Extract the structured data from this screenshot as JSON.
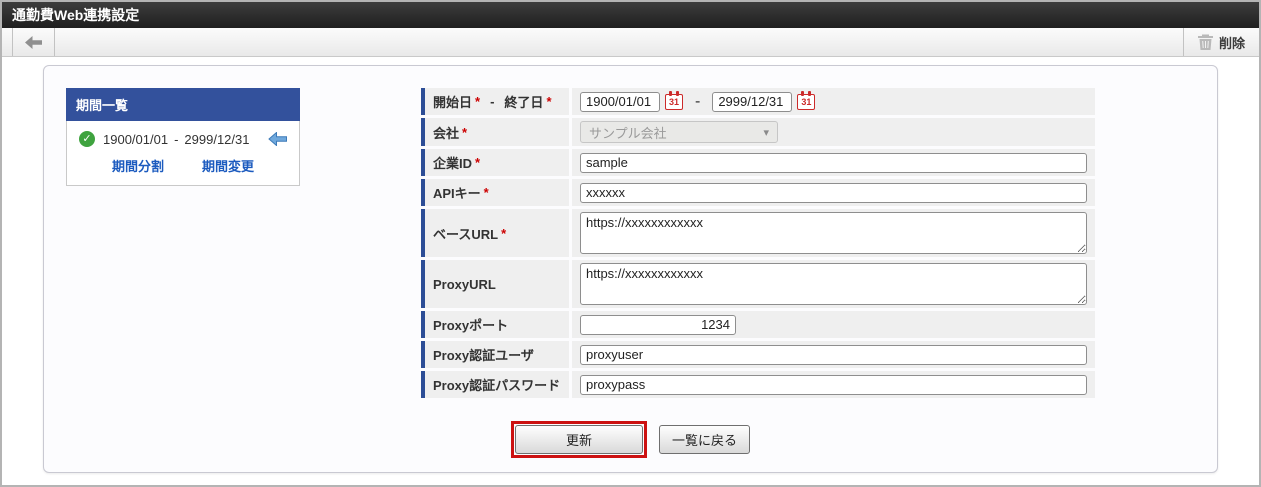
{
  "title_bar": {
    "title": "通勤費Web連携設定"
  },
  "toolbar": {
    "delete_label": "削除"
  },
  "period_panel": {
    "title": "期間一覧",
    "entry": {
      "start": "1900/01/01",
      "separator": "-",
      "end": "2999/12/31"
    },
    "links": {
      "split": "期間分割",
      "change": "期間変更"
    }
  },
  "form": {
    "required_marker": "*",
    "date_range": {
      "start_label": "開始日",
      "end_label": "終了日",
      "separator": "-",
      "start_value": "1900/01/01",
      "end_value": "2999/12/31"
    },
    "company": {
      "label": "会社",
      "value": "サンプル会社"
    },
    "company_id": {
      "label": "企業ID",
      "value": "sample"
    },
    "api_key": {
      "label": "APIキー",
      "value": "xxxxxx"
    },
    "base_url": {
      "label": "ベースURL",
      "value": "https://xxxxxxxxxxxx"
    },
    "proxy_url": {
      "label": "ProxyURL",
      "value": "https://xxxxxxxxxxxx"
    },
    "proxy_port": {
      "label": "Proxyポート",
      "value": "1234"
    },
    "proxy_user": {
      "label": "Proxy認証ユーザ",
      "value": "proxyuser"
    },
    "proxy_password": {
      "label": "Proxy認証パスワード",
      "value": "proxypass"
    }
  },
  "actions": {
    "update": "更新",
    "back_to_list": "一覧に戻る"
  },
  "colors": {
    "panel_header_blue": "#33519c",
    "label_accent_blue": "#2c4d96",
    "link_blue": "#1c5bbf",
    "highlight_red": "#cc1111",
    "check_green": "#3fa33f"
  }
}
